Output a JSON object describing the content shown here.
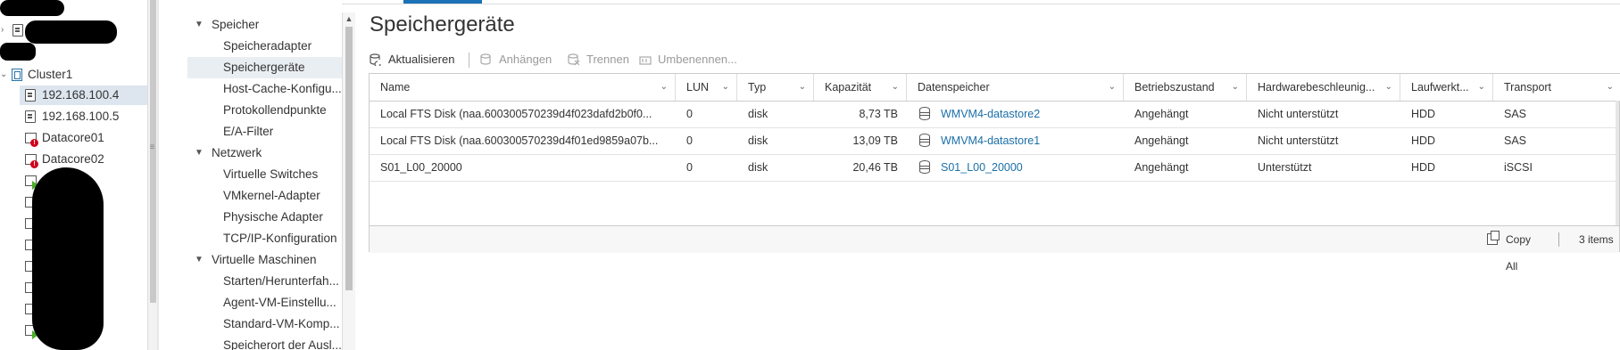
{
  "tree": {
    "items": [
      {
        "label": "",
        "type": "host-redacted"
      },
      {
        "label": "",
        "type": "host-redacted"
      },
      {
        "label": "",
        "type": "host-redacted"
      },
      {
        "label": "Cluster1",
        "type": "cluster"
      },
      {
        "label": "192.168.100.4",
        "type": "host",
        "selected": true
      },
      {
        "label": "192.168.100.5",
        "type": "host"
      },
      {
        "label": "Datacore01",
        "type": "vm-alert"
      },
      {
        "label": "Datacore02",
        "type": "vm-alert"
      }
    ]
  },
  "nav": {
    "groups": [
      {
        "label": "Speicher",
        "children": [
          "Speicheradapter",
          "Speichergeräte",
          "Host-Cache-Konfigu...",
          "Protokollendpunkte",
          "E/A-Filter"
        ]
      },
      {
        "label": "Netzwerk",
        "children": [
          "Virtuelle Switches",
          "VMkernel-Adapter",
          "Physische Adapter",
          "TCP/IP-Konfiguration"
        ]
      },
      {
        "label": "Virtuelle Maschinen",
        "children": [
          "Starten/Herunterfah...",
          "Agent-VM-Einstellu...",
          "Standard-VM-Komp...",
          "Speicherort der Ausl..."
        ]
      }
    ],
    "selected": "Speichergeräte"
  },
  "page": {
    "title": "Speichergeräte"
  },
  "toolbar": {
    "refresh": "Aktualisieren",
    "attach": "Anhängen",
    "detach": "Trennen",
    "rename": "Umbenennen..."
  },
  "grid": {
    "columns": [
      "Name",
      "LUN",
      "Typ",
      "Kapazität",
      "Datenspeicher",
      "Betriebszustand",
      "Hardwarebeschleunig...",
      "Laufwerkt...",
      "Transport"
    ],
    "rows": [
      {
        "name": "Local FTS Disk (naa.600300570239d4f023dafd2b0f0...",
        "lun": "0",
        "type": "disk",
        "capacity": "8,73 TB",
        "datastore": "WMVM4-datastore2",
        "state": "Angehängt",
        "hwaccel": "Nicht unterstützt",
        "drive": "HDD",
        "transport": "SAS"
      },
      {
        "name": "Local FTS Disk (naa.600300570239d4f01ed9859a07b...",
        "lun": "0",
        "type": "disk",
        "capacity": "13,09 TB",
        "datastore": "WMVM4-datastore1",
        "state": "Angehängt",
        "hwaccel": "Nicht unterstützt",
        "drive": "HDD",
        "transport": "SAS"
      },
      {
        "name": "S01_L00_20000",
        "lun": "0",
        "type": "disk",
        "capacity": "20,46 TB",
        "datastore": "S01_L00_20000",
        "state": "Angehängt",
        "hwaccel": "Unterstützt",
        "drive": "HDD",
        "transport": "iSCSI"
      }
    ],
    "footer": {
      "copy_all": "Copy All",
      "count": "3 items"
    }
  },
  "colors": {
    "accent": "#1b72b5",
    "link": "#1b6fa8",
    "selected_bg": "#dde6ef",
    "alert": "#d0021b",
    "running": "#4caf2a"
  }
}
